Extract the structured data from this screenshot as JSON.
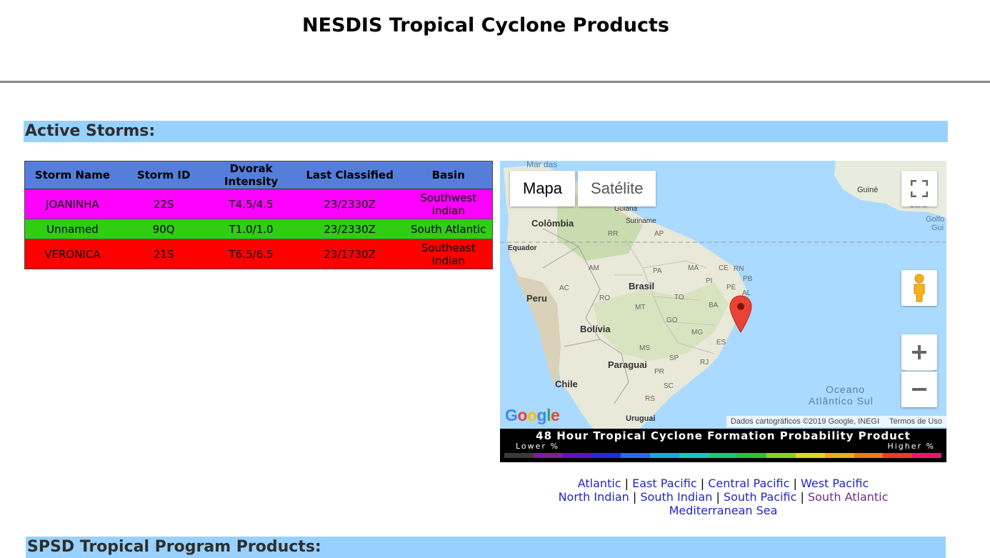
{
  "page": {
    "title": "NESDIS Tropical Cyclone Products"
  },
  "active_section": {
    "heading": "Active Storms:"
  },
  "storm_table": {
    "headers": [
      "Storm Name",
      "Storm ID",
      "Dvorak Intensity",
      "Last Classified",
      "Basin"
    ],
    "rows": [
      {
        "name": "JOANINHA",
        "id": "22S",
        "intensity": "T4.5/4.5",
        "classified": "23/2330Z",
        "basin": "Southwest Indian",
        "color": "#ff00ff"
      },
      {
        "name": "Unnamed",
        "id": "90Q",
        "intensity": "T1.0/1.0",
        "classified": "23/2330Z",
        "basin": "South Atlantic",
        "color": "#2fce12"
      },
      {
        "name": "VERONICA",
        "id": "21S",
        "intensity": "T6.5/6.5",
        "classified": "23/1730Z",
        "basin": "Southeast Indian",
        "color": "#ff0000"
      }
    ],
    "header_color": "#557edb"
  },
  "map": {
    "type_buttons": {
      "map": "Mapa",
      "satellite": "Satélite"
    },
    "labels": {
      "sea": "Mar das",
      "colombia": "Colômbia",
      "guiana": "Guiana",
      "suriname": "Suriname",
      "guine": "Guiné",
      "gana": "Gana",
      "golfo": "Golfo",
      "gui": "Gui",
      "equador": "Equador",
      "peru": "Peru",
      "brasil": "Brasil",
      "bolivia": "Bolívia",
      "paraguai": "Paraguai",
      "chile": "Chile",
      "uruguai": "Uruguai",
      "ocean_1": "Oceano",
      "ocean_2": "Atlântico Sul",
      "states": [
        "RR",
        "AP",
        "AM",
        "PA",
        "MA",
        "CE",
        "RN",
        "PB",
        "PI",
        "PE",
        "AL",
        "AC",
        "RO",
        "TO",
        "BA",
        "MT",
        "GO",
        "MG",
        "ES",
        "MS",
        "SP",
        "RJ",
        "PR",
        "SC",
        "RS"
      ]
    },
    "google_logo": "Google",
    "attribution": "Dados cartográficos ©2019 Google, INEGI",
    "terms": "Termos de Uso",
    "marker_icon": "map-pin-icon"
  },
  "legend": {
    "title": "48 Hour Tropical Cyclone Formation Probability Product",
    "lower": "Lower %",
    "higher": "Higher %",
    "colors": [
      "#3a3a3a",
      "#7a1fa0",
      "#5b14c4",
      "#2828e0",
      "#1e6ef0",
      "#18a8e8",
      "#18c8c0",
      "#18c878",
      "#28c828",
      "#8ad21e",
      "#dada1e",
      "#f0a81e",
      "#f07818",
      "#f03c18",
      "#e8186a"
    ]
  },
  "basin_links": {
    "line1": [
      "Atlantic",
      "East Pacific",
      "Central Pacific",
      "West Pacific"
    ],
    "line2": [
      "North Indian",
      "South Indian",
      "South Pacific",
      "South Atlantic"
    ],
    "line3": [
      "Mediterranean Sea"
    ],
    "separator": "|"
  },
  "spsd_section": {
    "heading": "SPSD Tropical Program Products:"
  }
}
